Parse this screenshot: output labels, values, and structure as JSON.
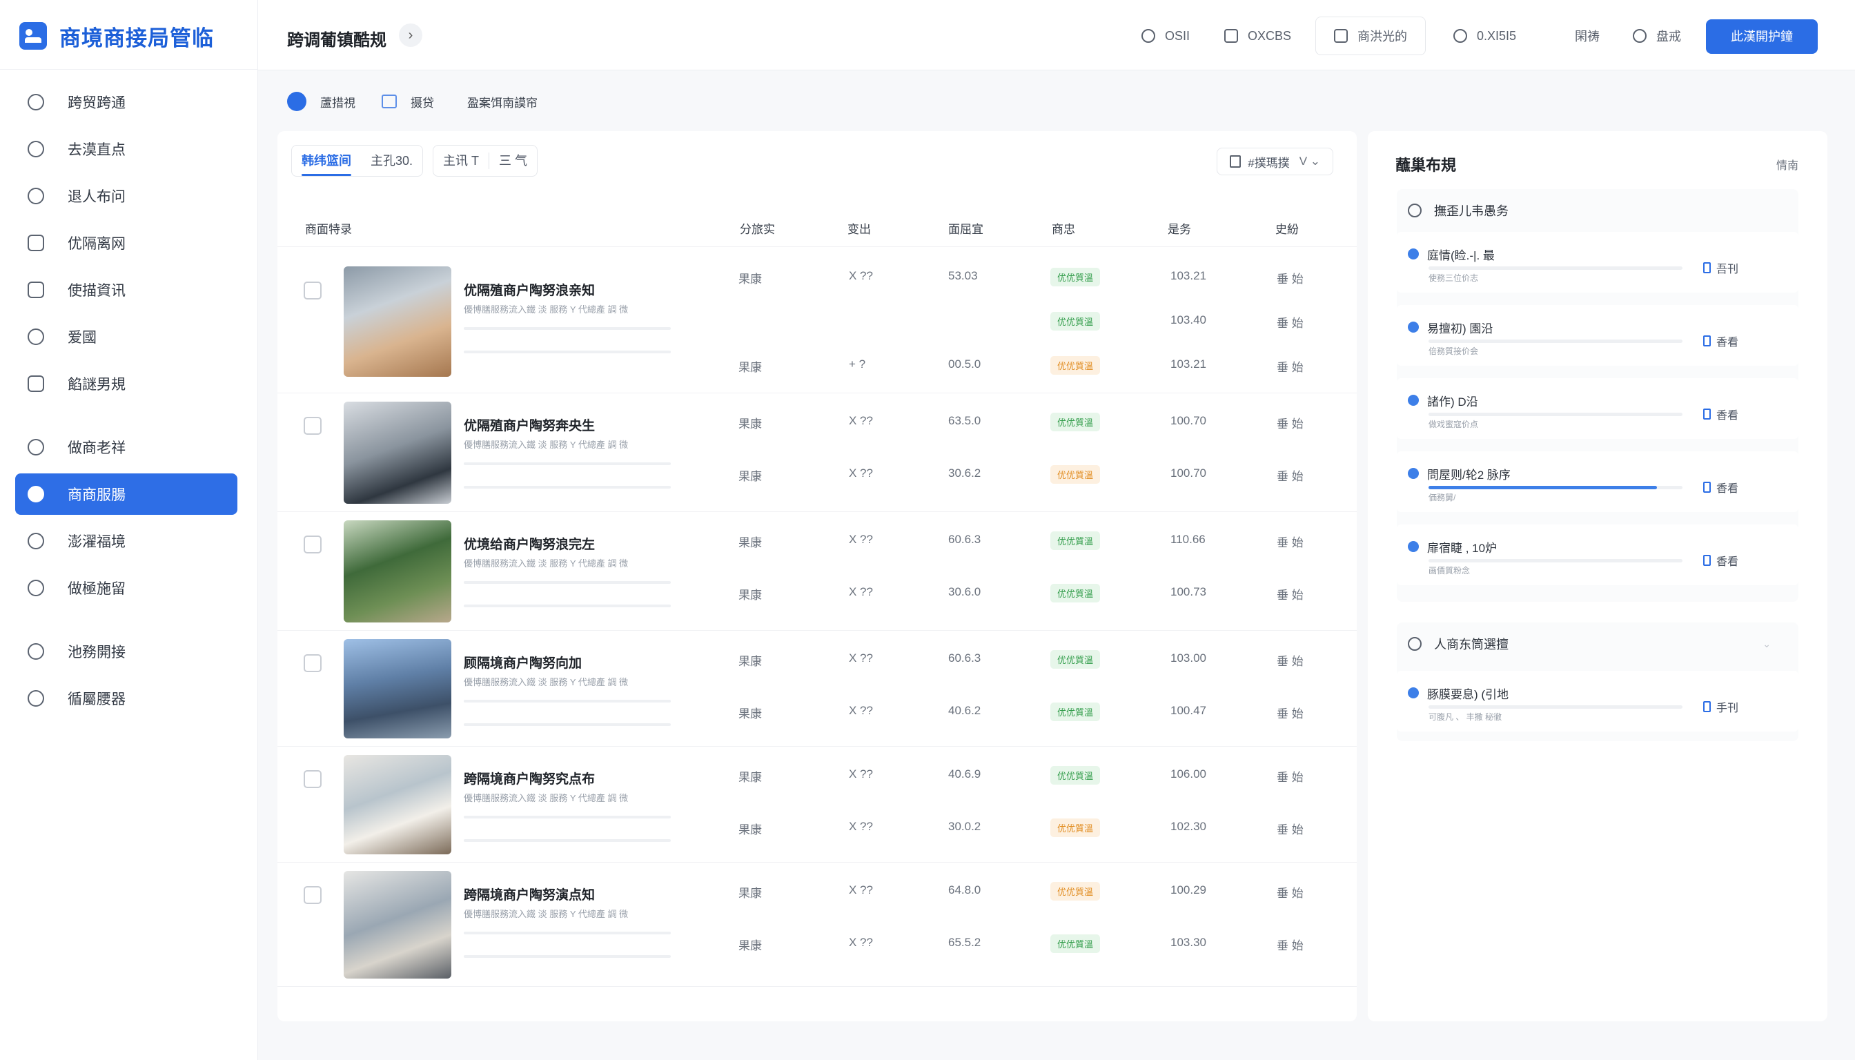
{
  "brand": {
    "title": "商境商接局管临"
  },
  "sidebar": {
    "items": [
      {
        "label": "跨贸跨通",
        "icon": "user-badge-icon"
      },
      {
        "label": "去漠直点",
        "icon": "person-icon"
      },
      {
        "label": "退人布问",
        "icon": "clock-icon"
      },
      {
        "label": "优隔离网",
        "icon": "calendar-check-icon"
      },
      {
        "label": "使描資讯",
        "icon": "document-icon"
      },
      {
        "label": "爱國",
        "icon": "compass-icon"
      },
      {
        "label": "餡謎男規",
        "icon": "file-icon"
      },
      {
        "label": "做商老祥",
        "icon": "chat-icon"
      },
      {
        "label": "商商服腸",
        "icon": "headset-icon"
      },
      {
        "label": "澎濯福境",
        "icon": "smile-icon"
      },
      {
        "label": "做極施留",
        "icon": "eye-icon"
      },
      {
        "label": "池務開接",
        "icon": "check-circle-icon"
      },
      {
        "label": "循屬腰器",
        "icon": "shield-icon"
      }
    ]
  },
  "topbar": {
    "title": "跨调葡镇酷规",
    "items": [
      "OSII",
      "OXCBS",
      "商洪光的",
      "0.XI5I5",
      "閑祷",
      "盘戒"
    ],
    "primary": "此漢開护鐘"
  },
  "breadcrumb": {
    "home": "蘆措視",
    "section": "摄贷",
    "current": "盈案饵南謨帘"
  },
  "tabs": {
    "group1": [
      "韩纬篮间",
      "主孔30."
    ],
    "group2": [
      "主讯 T",
      "三 气"
    ],
    "filter": "#撲瑪撲"
  },
  "table": {
    "headers": [
      "商面特录",
      "分旅实",
      "变出",
      "面屈宜",
      "商忠",
      "是务",
      "史紛"
    ],
    "rows": [
      {
        "title": "优隔殖商户陶努浪亲知",
        "sub": "優博膳服務流入鐵 淡 服務 Y 代總產 調 微",
        "photo": "office",
        "lines": [
          {
            "a": "果康",
            "b": "X ??",
            "c": "53.03",
            "status": "优优質溫",
            "tone": "green",
            "d": "103.21",
            "e": "垂 始"
          },
          {
            "a": "",
            "b": "",
            "c": "",
            "status": "优优質溫",
            "tone": "green",
            "d": "103.40",
            "e": "垂 始"
          },
          {
            "a": "果康",
            "b": "+ ?",
            "c": "00.5.0",
            "status": "优优質溫",
            "tone": "orange",
            "d": "103.21",
            "e": "垂 始"
          }
        ]
      },
      {
        "title": "优隔殖商户陶努奔央生",
        "sub": "優博膳服務流入鐵 淡 服務 Y 代總產 調 微",
        "photo": "car",
        "lines": [
          {
            "a": "果康",
            "b": "X ??",
            "c": "63.5.0",
            "status": "优优質溫",
            "tone": "green",
            "d": "100.70",
            "e": "垂 始"
          },
          {
            "a": "果康",
            "b": "X ??",
            "c": "30.6.2",
            "status": "优优質溫",
            "tone": "orange",
            "d": "100.70",
            "e": "垂 始"
          }
        ]
      },
      {
        "title": "优境给商户陶努浪完左",
        "sub": "優博膳服務流入鐵 淡 服務 Y 代總產 調 微",
        "photo": "garden",
        "lines": [
          {
            "a": "果康",
            "b": "X ??",
            "c": "60.6.3",
            "status": "优优質溫",
            "tone": "green",
            "d": "110.66",
            "e": "垂 始"
          },
          {
            "a": "果康",
            "b": "X ??",
            "c": "30.6.0",
            "status": "优优質溫",
            "tone": "green",
            "d": "100.73",
            "e": "垂 始"
          }
        ]
      },
      {
        "title": "顾隔境商户陶努向加",
        "sub": "優博膳服務流入鐵 淡 服務 Y 代總產 調 微",
        "photo": "city",
        "lines": [
          {
            "a": "果康",
            "b": "X ??",
            "c": "60.6.3",
            "status": "优优質溫",
            "tone": "green",
            "d": "103.00",
            "e": "垂 始"
          },
          {
            "a": "果康",
            "b": "X ??",
            "c": "40.6.2",
            "status": "优优質溫",
            "tone": "green",
            "d": "100.47",
            "e": "垂 始"
          }
        ]
      },
      {
        "title": "跨隔境商户陶努究点布",
        "sub": "優博膳服務流入鐵 淡 服務 Y 代總產 調 微",
        "photo": "bedroom",
        "lines": [
          {
            "a": "果康",
            "b": "X ??",
            "c": "40.6.9",
            "status": "优优質溫",
            "tone": "green",
            "d": "106.00",
            "e": "垂 始"
          },
          {
            "a": "果康",
            "b": "X ??",
            "c": "30.0.2",
            "status": "优优質溫",
            "tone": "orange",
            "d": "102.30",
            "e": "垂 始"
          }
        ]
      },
      {
        "title": "跨隔境商户陶努演点知",
        "sub": "優博膳服務流入鐵 淡 服務 Y 代總產 調 微",
        "photo": "workspace",
        "lines": [
          {
            "a": "果康",
            "b": "X ??",
            "c": "64.8.0",
            "status": "优优質溫",
            "tone": "orange",
            "d": "100.29",
            "e": "垂 始"
          },
          {
            "a": "果康",
            "b": "X ??",
            "c": "65.5.2",
            "status": "优优質溫",
            "tone": "green",
            "d": "103.30",
            "e": "垂 始"
          }
        ]
      }
    ]
  },
  "panel": {
    "title": "蘸巢布規",
    "link": "情南",
    "section1": "撫歪儿韦愚务",
    "tasks": [
      {
        "title": "庭情(睑.-|. 最",
        "sub": "使務三位价志",
        "progress": 0,
        "view": "吾刊"
      },
      {
        "title": "易擅初)  園沿",
        "sub": "倍務質接价会",
        "progress": 0,
        "view": "香看"
      },
      {
        "title": "諸作)  D沿",
        "sub": "做戏蜜寇价点",
        "progress": 0,
        "view": "香看"
      },
      {
        "title": "問屋则/轮2  脉序",
        "sub": "価務舅/",
        "progress": 0.9,
        "view": "香看"
      },
      {
        "title": "扉宿睫 ,  10炉",
        "sub": "画價質粉念",
        "progress": 0,
        "view": "香看"
      }
    ],
    "section2": "人商东筒選擅",
    "tasks2": [
      {
        "title": "豚膜要息)  (引地",
        "sub": "可腹凡 、 丰撒 秘徹",
        "progress": 0,
        "view": "手刊"
      }
    ]
  },
  "colors": {
    "accent": "#2b6de5",
    "green": "#2e9b47",
    "orange": "#e08a1c"
  }
}
